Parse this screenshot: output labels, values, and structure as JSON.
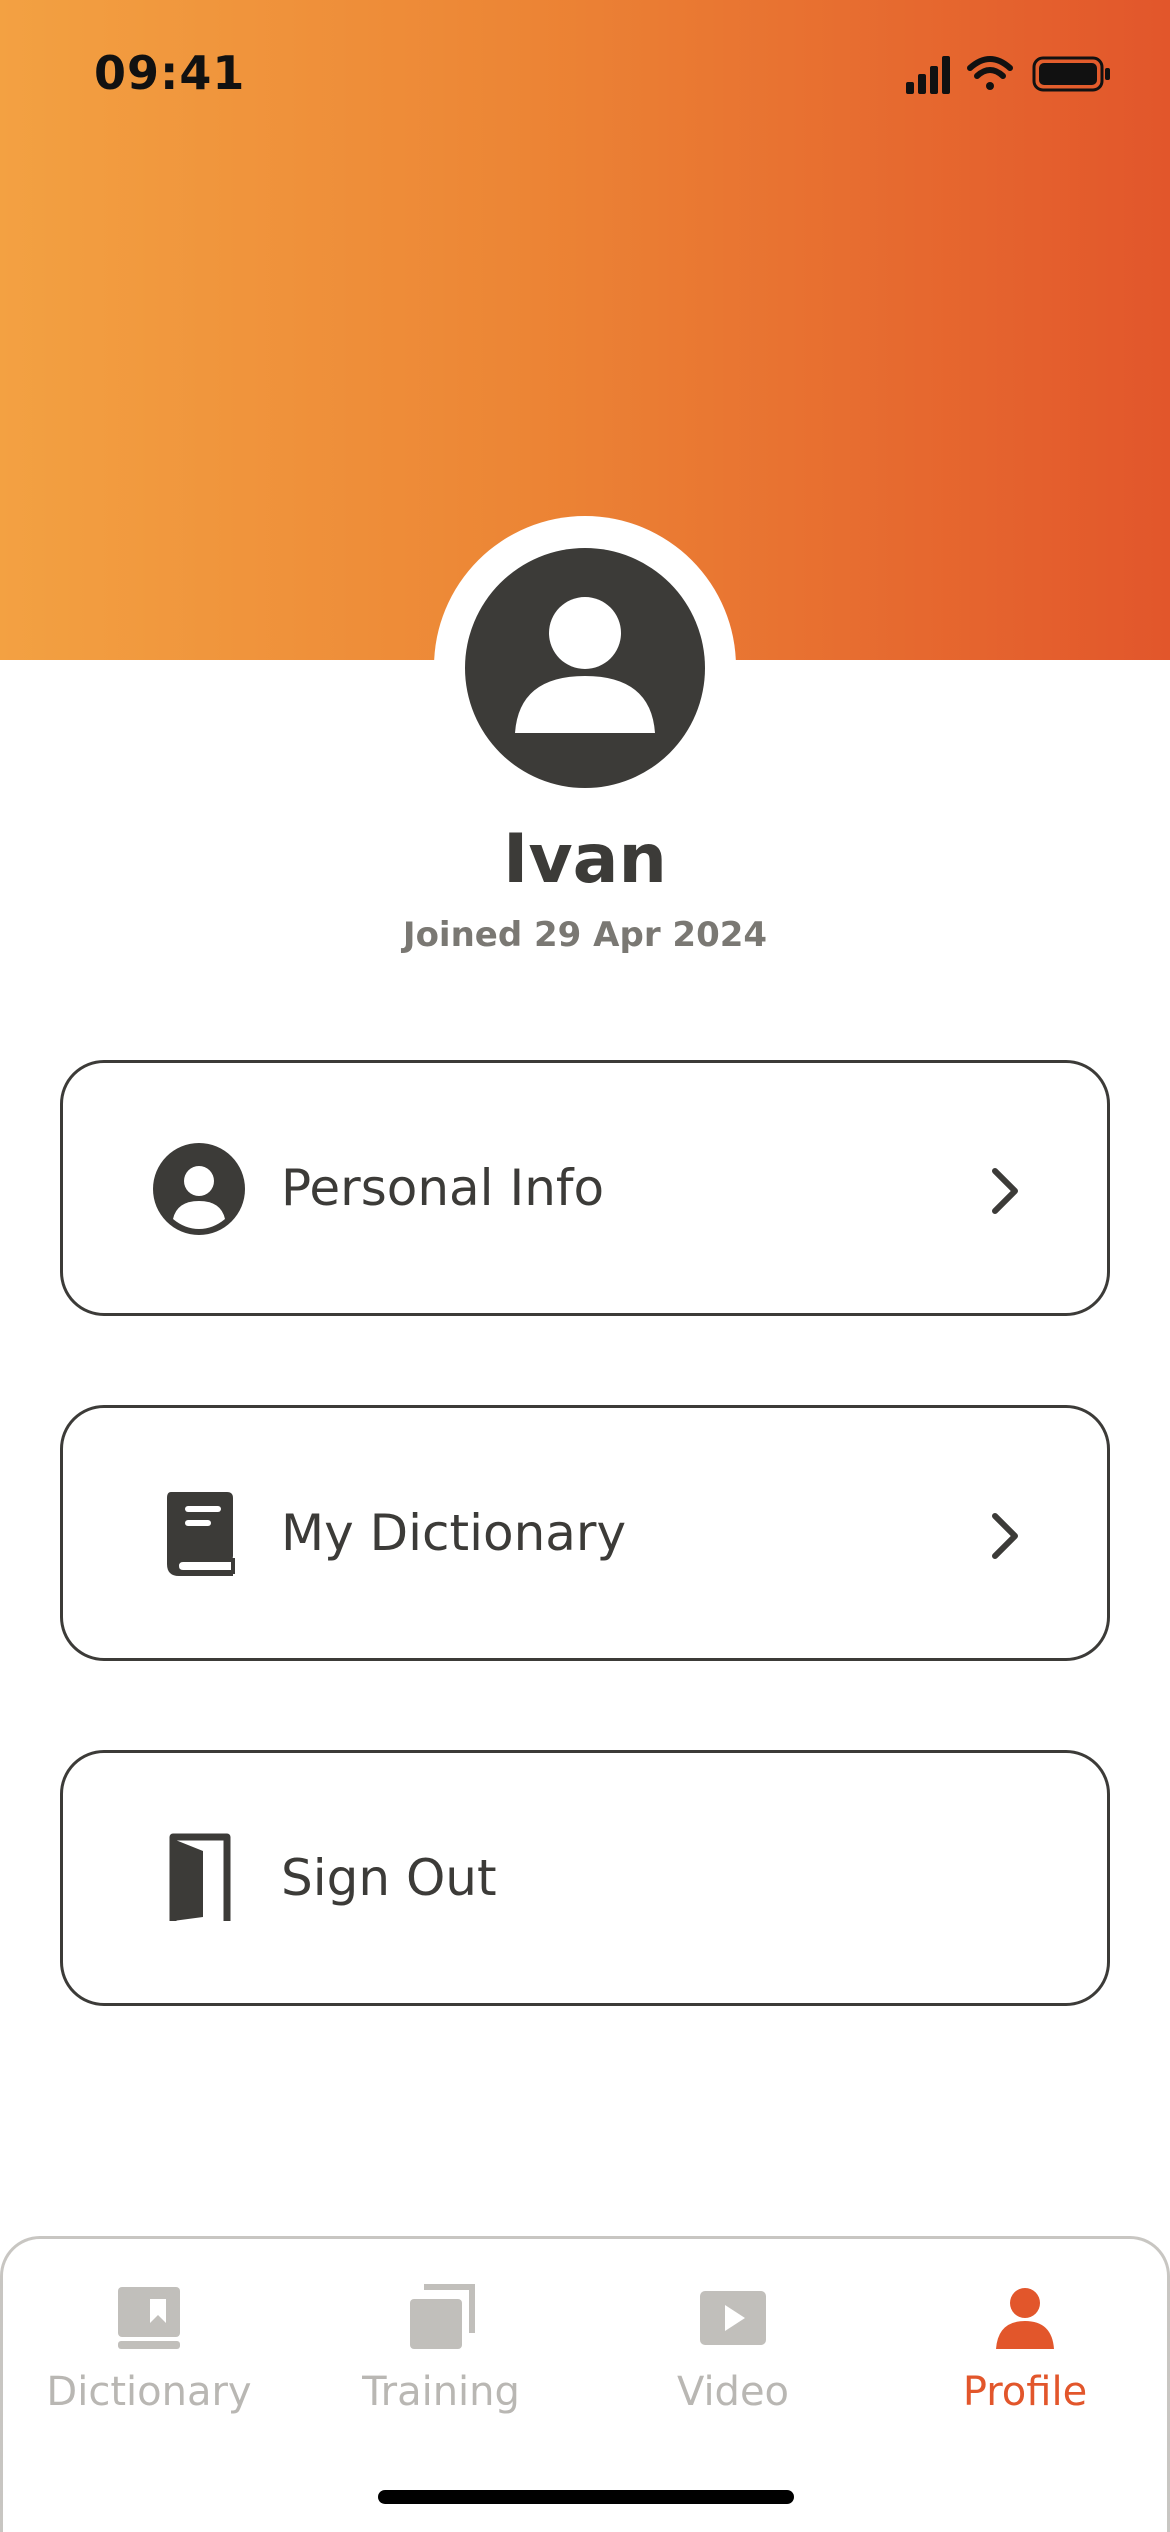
{
  "status_bar": {
    "time": "09:41"
  },
  "profile": {
    "name": "Ivan",
    "joined": "Joined 29 Apr 2024"
  },
  "menu": [
    {
      "label": "Personal Info",
      "icon": "user-circle-icon",
      "has_chevron": true
    },
    {
      "label": "My Dictionary",
      "icon": "book-icon",
      "has_chevron": true
    },
    {
      "label": "Sign Out",
      "icon": "door-icon",
      "has_chevron": false
    }
  ],
  "tabs": [
    {
      "label": "Dictionary",
      "icon": "dictionary-icon",
      "active": false
    },
    {
      "label": "Training",
      "icon": "training-icon",
      "active": false
    },
    {
      "label": "Video",
      "icon": "video-icon",
      "active": false
    },
    {
      "label": "Profile",
      "icon": "profile-icon",
      "active": true
    }
  ],
  "colors": {
    "gradient_start": "#f3a142",
    "gradient_end": "#e2562b",
    "accent": "#e2562b",
    "text_dark": "#3c3b38",
    "tab_inactive": "#b9b7b3"
  }
}
